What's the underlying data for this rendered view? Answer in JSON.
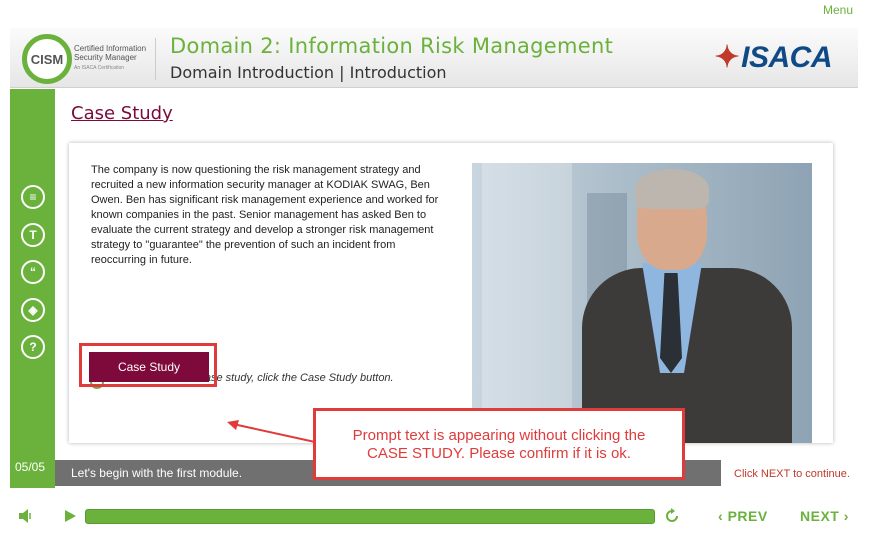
{
  "menu_label": "Menu",
  "header": {
    "logo_abbr": "CISM",
    "logo_line1": "Certified Information",
    "logo_line2": "Security Manager",
    "logo_line3": "An ISACA Certification",
    "domain_title": "Domain 2: Information Risk Management",
    "domain_subtitle": "Domain Introduction | Introduction",
    "brand": "ISACA"
  },
  "sidebar": {
    "icons": [
      {
        "name": "transcript-icon",
        "glyph": "≡"
      },
      {
        "name": "text-icon",
        "glyph": "T"
      },
      {
        "name": "quote-icon",
        "glyph": "“"
      },
      {
        "name": "resources-icon",
        "glyph": "◈"
      },
      {
        "name": "help-icon",
        "glyph": "?"
      }
    ],
    "page_counter": "05/05"
  },
  "main": {
    "title": "Case Study",
    "body": "The company is now questioning the risk management strategy and recruited a new information security manager at KODIAK SWAG, Ben Owen. Ben has significant risk management experience and worked for known companies in the past. Senior management has asked Ben to evaluate the current strategy and develop a stronger risk management strategy to \"guarantee\" the prevention of such an incident from reoccurring in future.",
    "hint": "To download the case study, click the Case Study button.",
    "case_button": "Case Study",
    "footer_text": "Let's begin with the first module.",
    "click_next": "Click NEXT to continue."
  },
  "annotation": {
    "callout_line1": "Prompt text is appearing without clicking the",
    "callout_line2": "CASE STUDY. Please confirm if it is ok."
  },
  "controls": {
    "progress": 1.0,
    "prev_label": "PREV",
    "next_label": "NEXT"
  },
  "colors": {
    "accent_green": "#6ab23c",
    "maroon": "#7d0a3a",
    "annotation_red": "#e03b3b"
  }
}
